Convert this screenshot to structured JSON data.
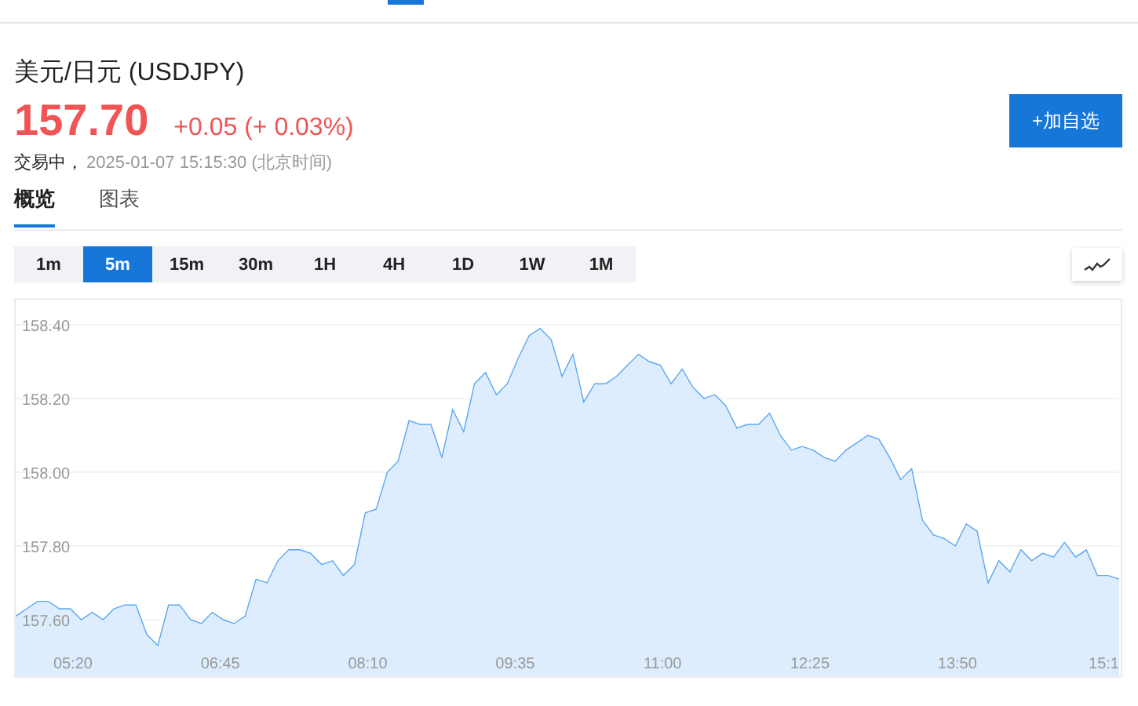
{
  "quote": {
    "title": "美元/日元 (USDJPY)",
    "price": "157.70",
    "change": "+0.05",
    "change_percent": "(+ 0.03%)",
    "status": "交易中，",
    "timestamp": "2025-01-07 15:15:30 (北京时间)"
  },
  "watch_button": {
    "label": "+加自选"
  },
  "tabs": [
    {
      "label": "概览",
      "selected": true
    },
    {
      "label": "图表",
      "selected": false
    }
  ],
  "periods": [
    {
      "label": "1m",
      "selected": false
    },
    {
      "label": "5m",
      "selected": true
    },
    {
      "label": "15m",
      "selected": false
    },
    {
      "label": "30m",
      "selected": false
    },
    {
      "label": "1H",
      "selected": false
    },
    {
      "label": "4H",
      "selected": false
    },
    {
      "label": "1D",
      "selected": false
    },
    {
      "label": "1W",
      "selected": false
    },
    {
      "label": "1M",
      "selected": false
    }
  ],
  "chart": {
    "chart_data": {
      "type": "area",
      "grid": true,
      "xlim": [
        287,
        923.3
      ],
      "ylim": [
        157.447,
        158.468
      ],
      "x": [
        287,
        293.3,
        299.6,
        305.9,
        312.2,
        318.5,
        324.8,
        331.1,
        337.4,
        343.7,
        350,
        356.3,
        362.6,
        368.9,
        375.2,
        381.5,
        387.8,
        394.1,
        400.4,
        406.7,
        413,
        419.3,
        425.6,
        431.9,
        438.2,
        444.5,
        450.8,
        457.1,
        463.4,
        469.7,
        476,
        482.3,
        488.6,
        494.9,
        501.2,
        507.5,
        513.8,
        520.1,
        526.4,
        532.7,
        539,
        545.3,
        551.6,
        557.9,
        564.2,
        570.5,
        576.8,
        583.1,
        589.4,
        595.7,
        602,
        608.3,
        614.6,
        620.9,
        627.2,
        633.5,
        639.8,
        646.1,
        652.4,
        658.7,
        665,
        671.3,
        677.6,
        683.9,
        690.2,
        696.5,
        702.8,
        709.1,
        715.4,
        721.7,
        728,
        734.3,
        740.6,
        746.9,
        753.2,
        759.5,
        765.8,
        772.1,
        778.4,
        784.7,
        791,
        797.3,
        803.6,
        809.9,
        816.2,
        822.5,
        828.8,
        835.1,
        841.4,
        847.7,
        854,
        860.3,
        866.6,
        872.9,
        879.2,
        885.5,
        891.8,
        898.1,
        904.4,
        910.7,
        917,
        923.3
      ],
      "yticks": [
        {
          "value": 157.6,
          "label": "157.60"
        },
        {
          "value": 157.8,
          "label": "157.80"
        },
        {
          "value": 158.0,
          "label": "158.00"
        },
        {
          "value": 158.2,
          "label": "158.20"
        },
        {
          "value": 158.4,
          "label": "158.40"
        }
      ],
      "xticks": [
        {
          "value": 320,
          "label": "05:20"
        },
        {
          "value": 405,
          "label": "06:45"
        },
        {
          "value": 490,
          "label": "08:10"
        },
        {
          "value": 575,
          "label": "09:35"
        },
        {
          "value": 660,
          "label": "11:00"
        },
        {
          "value": 745,
          "label": "12:25"
        },
        {
          "value": 830,
          "label": "13:50"
        },
        {
          "value": 915,
          "label": "15:1"
        }
      ],
      "series": [
        {
          "color": "#5aa8f0",
          "values": [
            157.61,
            157.63,
            157.65,
            157.65,
            157.63,
            157.63,
            157.6,
            157.62,
            157.6,
            157.63,
            157.64,
            157.64,
            157.56,
            157.53,
            157.64,
            157.64,
            157.6,
            157.59,
            157.62,
            157.6,
            157.59,
            157.61,
            157.71,
            157.7,
            157.76,
            157.79,
            157.79,
            157.78,
            157.75,
            157.76,
            157.72,
            157.75,
            157.89,
            157.9,
            158.0,
            158.03,
            158.14,
            158.13,
            158.13,
            158.04,
            158.17,
            158.11,
            158.24,
            158.27,
            158.21,
            158.24,
            158.31,
            158.37,
            158.39,
            158.36,
            158.26,
            158.32,
            158.19,
            158.24,
            158.24,
            158.26,
            158.29,
            158.32,
            158.3,
            158.29,
            158.24,
            158.28,
            158.23,
            158.2,
            158.21,
            158.18,
            158.12,
            158.13,
            158.13,
            158.16,
            158.1,
            158.06,
            158.07,
            158.06,
            158.04,
            158.03,
            158.06,
            158.08,
            158.1,
            158.09,
            158.04,
            157.98,
            158.01,
            157.87,
            157.83,
            157.82,
            157.8,
            157.86,
            157.84,
            157.7,
            157.76,
            157.73,
            157.79,
            157.76,
            157.78,
            157.77,
            157.81,
            157.77,
            157.79,
            157.72,
            157.72,
            157.71
          ]
        }
      ]
    }
  }
}
